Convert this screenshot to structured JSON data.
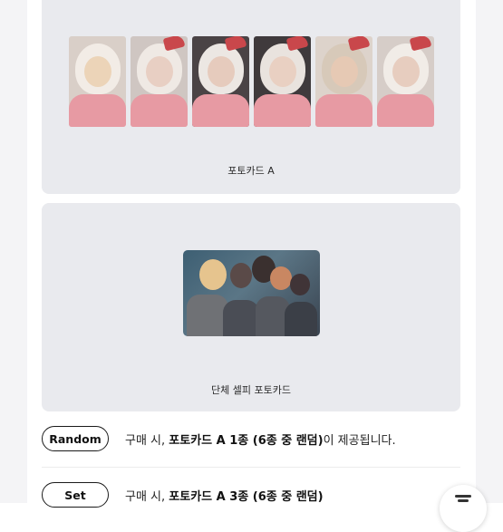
{
  "cards": [
    {
      "label": "포토카드 A",
      "thumbnail_count": 6
    },
    {
      "label": "단체 셀피 포토카드"
    }
  ],
  "options": [
    {
      "pill": "Random",
      "prefix": "구매 시, ",
      "bold": "포토카드 A 1종 (6종 중 랜덤)",
      "suffix": "이 제공됩니다."
    },
    {
      "pill": "Set",
      "prefix": "구매 시, ",
      "bold": "포토카드 A 3종 (6종 중 랜덤)",
      "suffix": ""
    }
  ],
  "colors": {
    "card_bg": "#e9eaee",
    "pill_border": "#1a1a1a",
    "photocard_pink": "#e79aa3",
    "santa_red": "#c9474b"
  }
}
